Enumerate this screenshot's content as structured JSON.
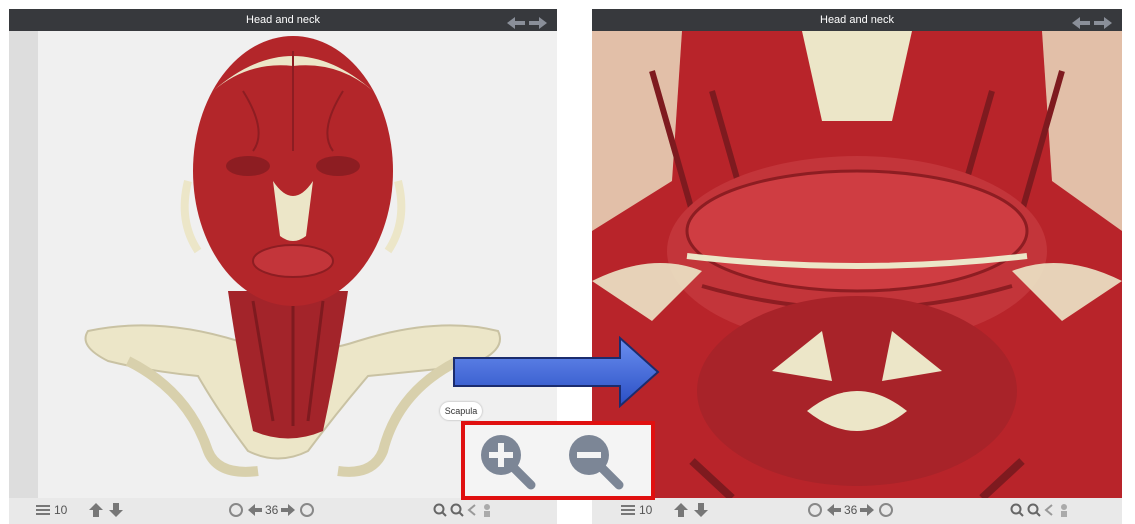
{
  "left_window": {
    "title": "Head and neck",
    "tooltip": "Scapula",
    "layer_count": "10",
    "step_count": "36"
  },
  "right_window": {
    "title": "Head and neck",
    "layer_count": "10",
    "step_count": "36"
  },
  "callout": {
    "zoom_in_icon": "zoom-in-magnifier",
    "zoom_out_icon": "zoom-out-magnifier",
    "highlight_color": "#e01010"
  },
  "colors": {
    "muscle": "#b3262a",
    "bone": "#ece6c8",
    "arrow": "#3a63d8"
  }
}
